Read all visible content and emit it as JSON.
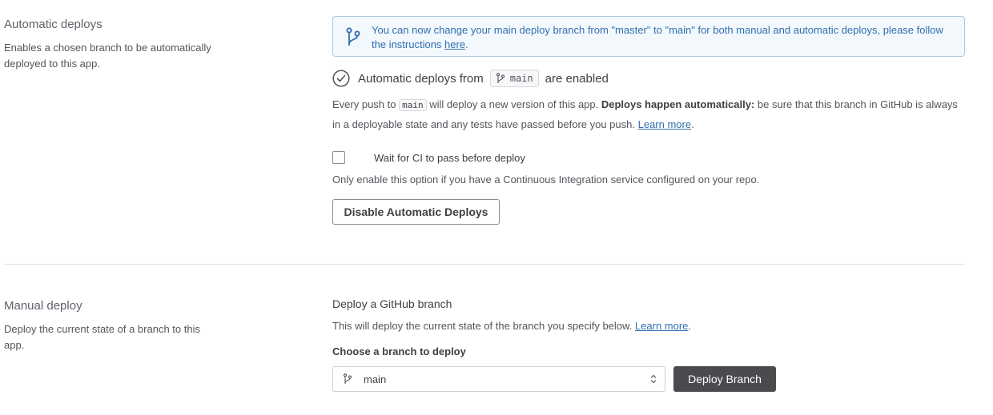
{
  "automatic": {
    "title": "Automatic deploys",
    "description": "Enables a chosen branch to be automatically deployed to this app.",
    "info": {
      "text": "You can now change your main deploy branch from \"master\" to \"main\" for both manual and automatic deploys, please follow the instructions ",
      "link": "here",
      "suffix": "."
    },
    "enabled": {
      "prefix": "Automatic deploys from",
      "branch": "main",
      "suffix": "are enabled"
    },
    "push_text": {
      "p1": "Every push to",
      "branch": "main",
      "p2": " will deploy a new version of this app. ",
      "bold": "Deploys happen automatically:",
      "p3": " be sure that this branch in GitHub is always in a deployable state and any tests have passed before you push. ",
      "link": "Learn more",
      "end": "."
    },
    "ci": {
      "label": "Wait for CI to pass before deploy",
      "help": "Only enable this option if you have a Continuous Integration service configured on your repo.",
      "checked": false
    },
    "disable_button": "Disable Automatic Deploys"
  },
  "manual": {
    "title": "Manual deploy",
    "description": "Deploy the current state of a branch to this app.",
    "deploy_title": "Deploy a GitHub branch",
    "deploy_help": "This will deploy the current state of the branch you specify below. ",
    "deploy_help_link": "Learn more",
    "deploy_help_end": ".",
    "choose_label": "Choose a branch to deploy",
    "selected_branch": "main",
    "deploy_button": "Deploy Branch"
  },
  "icons": {
    "branch": "git-branch-icon",
    "check": "check-circle-icon",
    "chevron": "select-chevron-icon"
  },
  "colors": {
    "info_bg": "#f3f8fd",
    "info_border": "#a9c8e6",
    "info_text": "#2f6fae",
    "dark_button": "#4a4a4f"
  }
}
